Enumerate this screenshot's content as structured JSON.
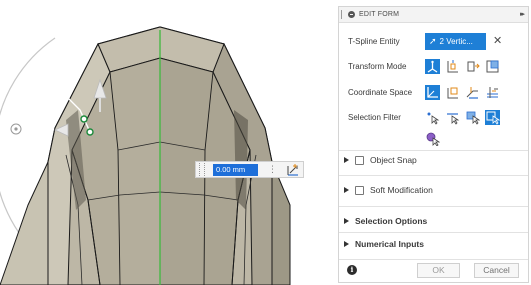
{
  "viewport": {
    "dimension_input": {
      "value": "0.00 mm"
    },
    "icons": [
      "grip-icon",
      "more-options-icon",
      "sketch-dimension-icon",
      "move-gizmo-icon"
    ]
  },
  "form": {
    "title": "EDIT FORM",
    "collapse_glyph": "▸▸",
    "tspline_entity": {
      "label": "T-Spline Entity",
      "value": "2 Vertic...",
      "clear_glyph": "✕"
    },
    "transform_mode": {
      "label": "Transform Mode",
      "icons": [
        "multi-transform-icon",
        "translation-icon",
        "rotation-icon",
        "scale-icon"
      ],
      "selected": 0
    },
    "coordinate_space": {
      "label": "Coordinate Space",
      "icons": [
        "world-space-icon",
        "view-space-icon",
        "local-space-icon",
        "per-face-icon"
      ],
      "selected": 0
    },
    "selection_filter": {
      "label": "Selection Filter",
      "icons": [
        "vertex-filter-icon",
        "edge-filter-icon",
        "face-filter-icon",
        "body-filter-icon",
        "all-filter-icon"
      ],
      "selected": 3
    },
    "sections": [
      {
        "label": "Object Snap",
        "has_checkbox": true
      },
      {
        "label": "Soft Modification",
        "has_checkbox": true
      },
      {
        "label": "Selection Options",
        "has_checkbox": false
      },
      {
        "label": "Numerical Inputs",
        "has_checkbox": false
      }
    ],
    "footer": {
      "info_glyph": "i",
      "ok_label": "OK",
      "cancel_label": "Cancel"
    }
  },
  "colors": {
    "accent": "#1e7fd6",
    "model_face": "#b8b2a0",
    "model_edge": "#1a1a1a",
    "axis_green": "#3fb93f"
  }
}
